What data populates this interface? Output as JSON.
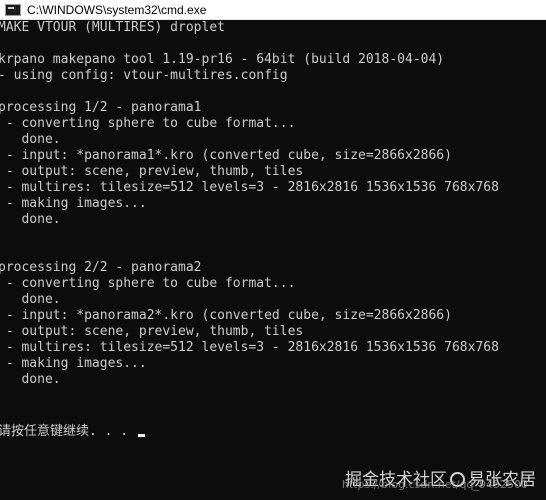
{
  "window": {
    "title": "C:\\WINDOWS\\system32\\cmd.exe",
    "icon": "cmd-icon"
  },
  "console": {
    "lines": [
      "MAKE VTOUR (MULTIRES) droplet",
      "",
      "krpano makepano tool 1.19-pr16 - 64bit (build 2018-04-04)",
      "- using config: vtour-multires.config",
      "",
      "processing 1/2 - panorama1",
      " - converting sphere to cube format...",
      "   done.",
      " - input: *panorama1*.kro (converted cube, size=2866x2866)",
      " - output: scene, preview, thumb, tiles",
      " - multires: tilesize=512 levels=3 - 2816x2816 1536x1536 768x768",
      " - making images...",
      "   done.",
      "",
      "",
      "",
      "processing 2/2 - panorama2",
      " - converting sphere to cube format...",
      "   done.",
      " - input: *panorama2*.kro (converted cube, size=2866x2866)",
      " - output: scene, preview, thumb, tiles",
      " - multires: tilesize=512 levels=3 - 2816x2816 1536x1536 768x768",
      " - making images...",
      "   done.",
      "",
      "",
      "请按任意键继续. . . "
    ]
  },
  "watermark": {
    "text_left": "掘金技术社区",
    "logo": "at-logo-icon",
    "text_right": "易张农居",
    "url": "https://blog.csdn.net/qq_9452500"
  }
}
